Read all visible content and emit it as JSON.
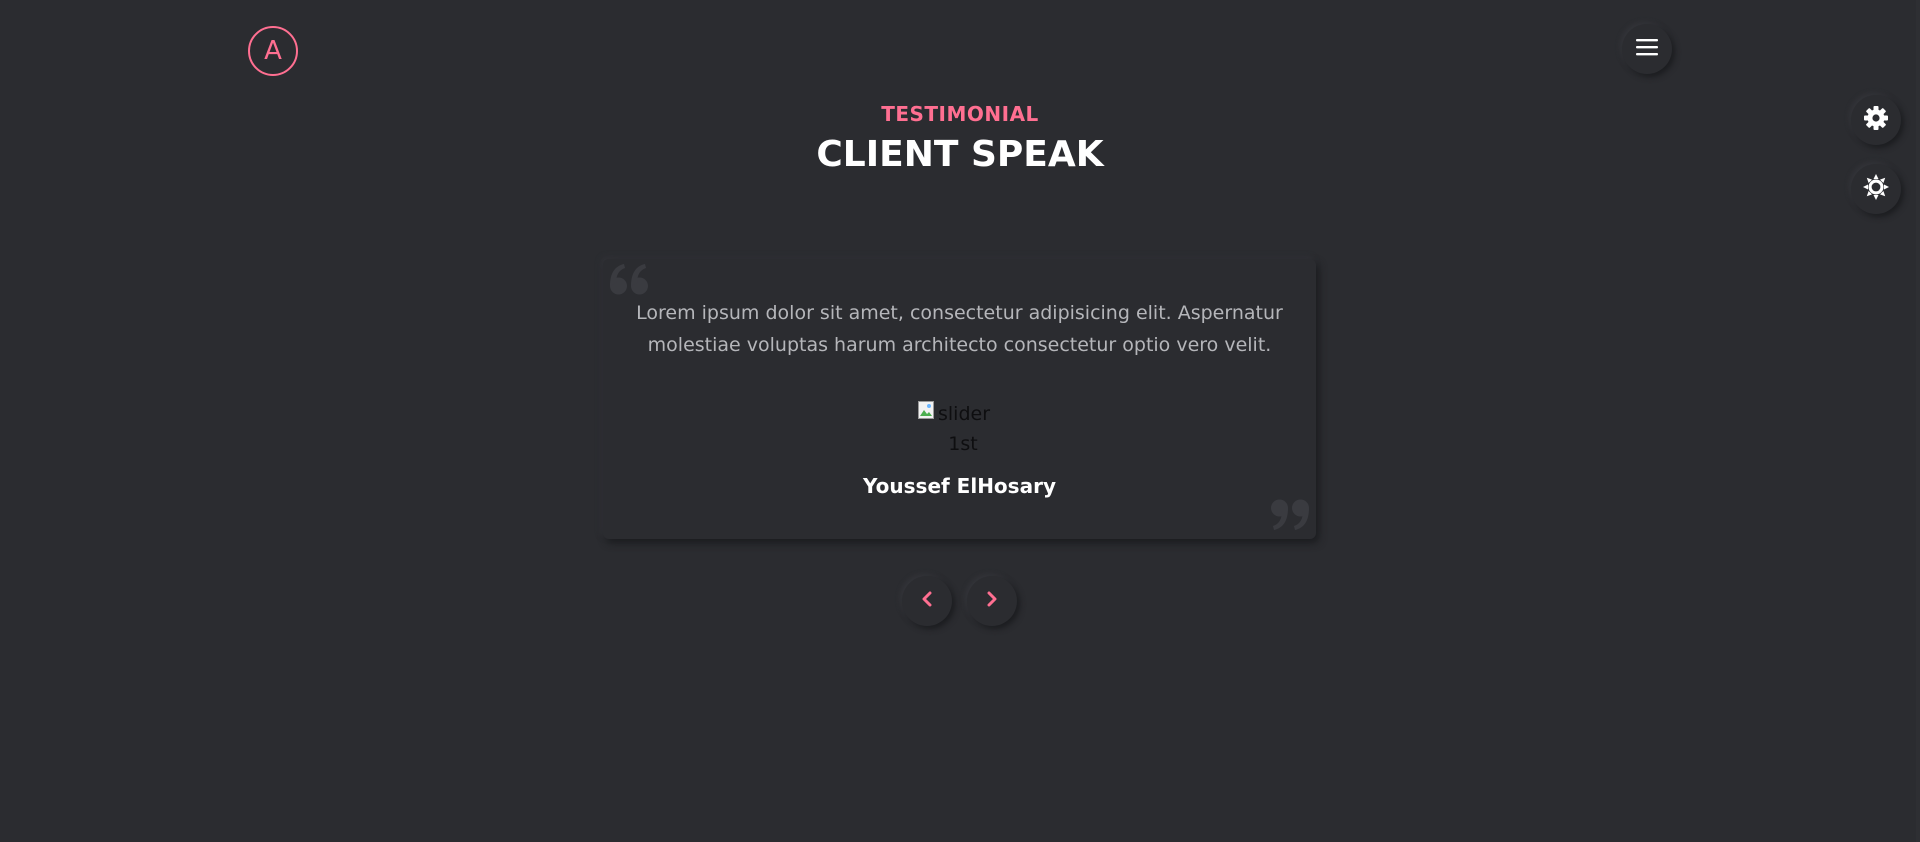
{
  "header": {
    "logo_letter": "A",
    "menu_icon": "hamburger-icon"
  },
  "side_controls": {
    "settings_icon": "gear-icon",
    "theme_icon": "sun-icon"
  },
  "section": {
    "subtitle": "TESTIMONIAL",
    "title": "CLIENT SPEAK"
  },
  "slider": {
    "text": "Lorem ipsum dolor sit amet, consectetur adipisicing elit. Aspernatur molestiae voluptas harum architecto consectetur optio vero velit.",
    "image_alt_line1": "slider",
    "image_alt_line2": "1st",
    "client_name": "Youssef ElHosary",
    "prev_icon": "chevron-left-icon",
    "next_icon": "chevron-right-icon"
  },
  "colors": {
    "background": "#2b2c30",
    "accent": "#ff6f91",
    "heading": "#ffffff",
    "body_text": "#b5b6ba"
  }
}
